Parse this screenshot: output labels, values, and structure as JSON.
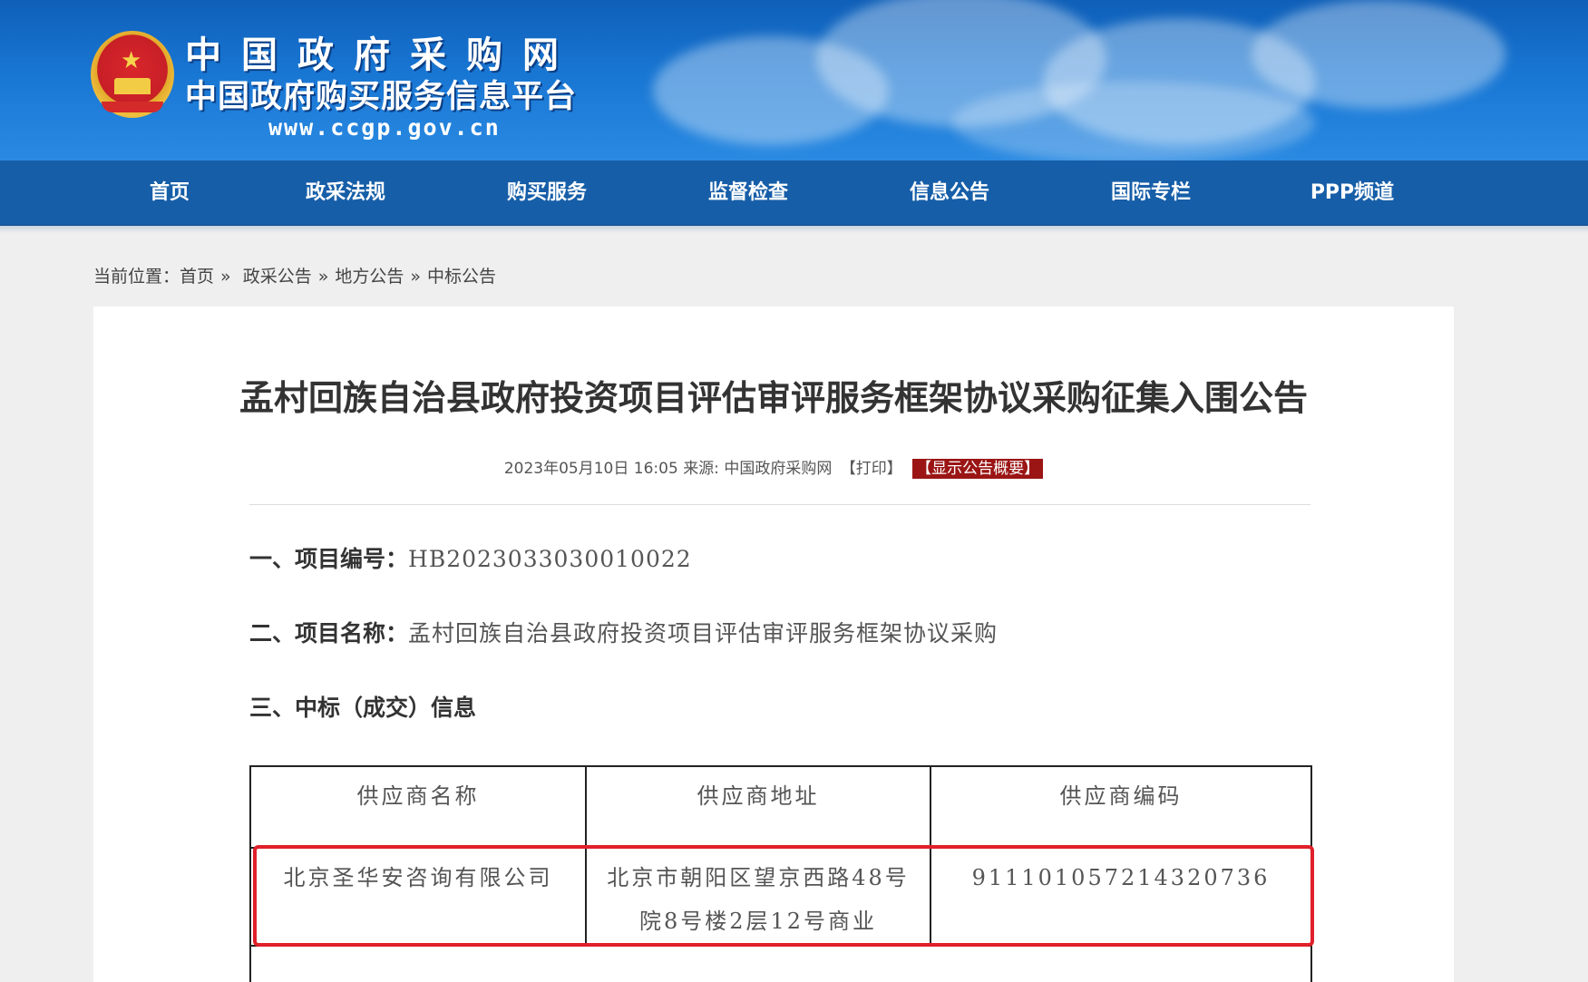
{
  "header": {
    "site_title": "中国政府采购网",
    "site_subtitle": "中国政府购买服务信息平台",
    "site_url": "www.ccgp.gov.cn"
  },
  "nav": {
    "items": [
      {
        "label": "首页"
      },
      {
        "label": "政采法规"
      },
      {
        "label": "购买服务"
      },
      {
        "label": "监督检查"
      },
      {
        "label": "信息公告"
      },
      {
        "label": "国际专栏"
      },
      {
        "label": "PPP频道"
      }
    ]
  },
  "breadcrumb": {
    "prefix": "当前位置：",
    "items": [
      "首页",
      "政采公告",
      "地方公告",
      "中标公告"
    ],
    "separator": "»"
  },
  "article": {
    "title": "孟村回族自治县政府投资项目评估审评服务框架协议采购征集入围公告",
    "meta": {
      "datetime": "2023年05月10日 16:05",
      "source_label": "来源:",
      "source": "中国政府采购网",
      "print_label": "【打印】",
      "summary_label": "【显示公告概要】"
    },
    "sections": [
      {
        "label": "一、项目编号：",
        "value": "HB2023033030010022"
      },
      {
        "label": "二、项目名称：",
        "value": "孟村回族自治县政府投资项目评估审评服务框架协议采购"
      },
      {
        "label": "三、中标（成交）信息",
        "value": ""
      }
    ],
    "table": {
      "headers": [
        "供应商名称",
        "供应商地址",
        "供应商编码"
      ],
      "rows": [
        {
          "name": "北京圣华安咨询有限公司",
          "address": "北京市朝阳区望京西路48号院8号楼2层12号商业",
          "code": "911101057214320736"
        }
      ]
    }
  },
  "colors": {
    "banner_blue": "#1876d3",
    "nav_blue": "#165ea8",
    "summary_red": "#9b1515",
    "highlight_red": "#e0202a"
  }
}
